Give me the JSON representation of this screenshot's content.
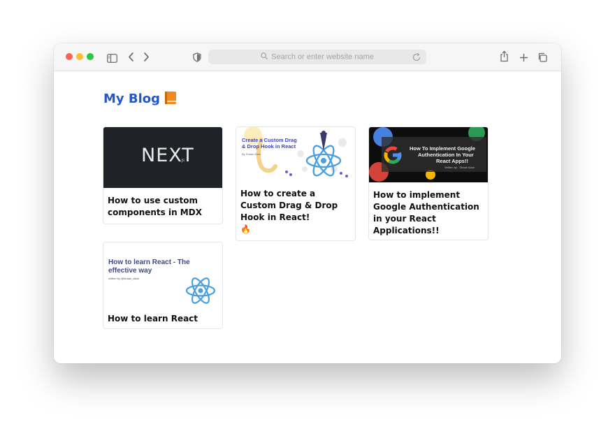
{
  "browser": {
    "address_placeholder": "Search or enter website name"
  },
  "page": {
    "title": "My Blog",
    "posts": [
      {
        "title": "How to use custom components in MDX",
        "thumb_text": "NEXT",
        "thumb_subtext": ".js"
      },
      {
        "title": "How to create a Custom Drag & Drop Hook in React!",
        "title_emoji": "🔥",
        "thumb_text_line1": "Create a Custom Drag",
        "thumb_text_line2": "& Drop Hook in React",
        "thumb_byline": "By Shaan Alam"
      },
      {
        "title": "How to implement Google Authentication in your React Applications!!",
        "thumb_text_line1": "How To Implement Google",
        "thumb_text_line2": "Authentication In Your",
        "thumb_text_line3": "React Apps!!",
        "thumb_byline": "Written by - Shaan Alam"
      },
      {
        "title": "How to learn React",
        "thumb_text_line1": "How to learn React - The",
        "thumb_text_line2": "effective way",
        "thumb_byline": "written by @shaan_alam"
      }
    ]
  },
  "colors": {
    "title_blue": "#2458c9",
    "react_blue": "#4a9fe0",
    "next_bg": "#1f2328"
  }
}
